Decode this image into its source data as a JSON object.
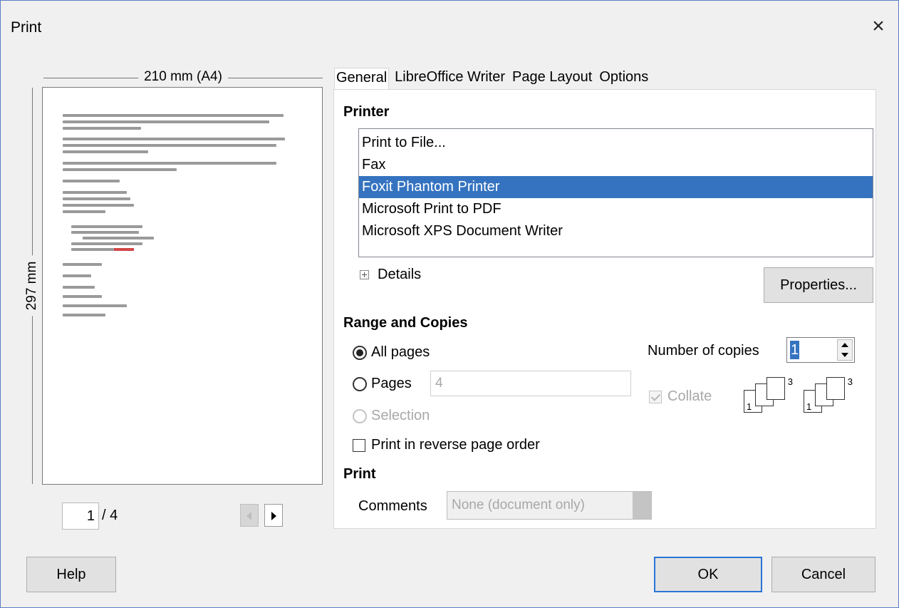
{
  "window": {
    "title": "Print",
    "close_label": "×"
  },
  "preview": {
    "width_label": "210 mm (A4)",
    "height_label": "297 mm",
    "current_page": "1",
    "total_pages": "/ 4"
  },
  "tabs": [
    {
      "label": "General"
    },
    {
      "label": "LibreOffice Writer"
    },
    {
      "label": "Page Layout"
    },
    {
      "label": "Options"
    }
  ],
  "printer": {
    "section_title": "Printer",
    "items": [
      {
        "label": "Print to File..."
      },
      {
        "label": "Fax"
      },
      {
        "label": "Foxit Phantom Printer"
      },
      {
        "label": "Microsoft Print to PDF"
      },
      {
        "label": "Microsoft XPS Document Writer"
      }
    ],
    "selected_index": 2,
    "details_label": "Details",
    "properties_label": "Properties..."
  },
  "range": {
    "section_title": "Range and Copies",
    "all_pages_label": "All pages",
    "pages_label": "Pages",
    "pages_value": "4",
    "selection_label": "Selection",
    "reverse_label": "Print in reverse page order",
    "copies_label": "Number of copies",
    "copies_value": "1",
    "collate_label": "Collate"
  },
  "print_section": {
    "section_title": "Print",
    "comments_label": "Comments",
    "comments_value": "None (document only)"
  },
  "buttons": {
    "help": "Help",
    "ok": "OK",
    "cancel": "Cancel"
  },
  "colors": {
    "selection": "#3573c0",
    "accent_border": "#2a74d6"
  }
}
